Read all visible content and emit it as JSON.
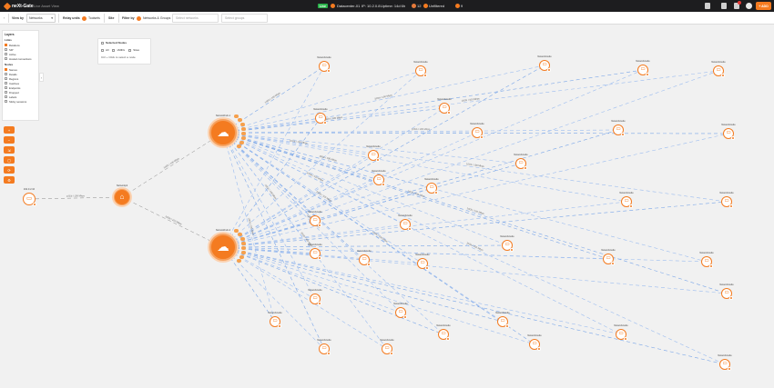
{
  "header": {
    "app_name": "neXt-Gate",
    "app_sub": "Live Asset View",
    "env_badge": "Live",
    "host": "Datacenter-01",
    "ip": "IP: 10.2.0.8",
    "status": "Uptime: 14d 6h",
    "alerts": "12",
    "tag": "Unfiltered",
    "count": "9",
    "add_label": "+ ADD"
  },
  "filters": {
    "view_by_label": "View by",
    "view_by_value": "Networks",
    "relay_label": "Relay units",
    "relay_value": "Toolsets",
    "site_label": "Site",
    "filter_by_label": "Filter by",
    "filter_by_value": "Networks & Groups",
    "search_networks_placeholder": "Select networks",
    "search_groups_placeholder": "Select groups"
  },
  "layers": {
    "title": "Layers",
    "links_title": "Links",
    "links": [
      {
        "label": "Relations",
        "on": true
      },
      {
        "label": "SIP",
        "on": false
      },
      {
        "label": "Active",
        "on": false
      },
      {
        "label": "Hosted connections",
        "on": false
      }
    ],
    "nodes_title": "Nodes",
    "nodes": [
      {
        "label": "Names",
        "on": true
      },
      {
        "label": "Details",
        "on": false
      },
      {
        "label": "Regions",
        "on": false
      },
      {
        "label": "Inactives",
        "on": false
      },
      {
        "label": "Endpoints",
        "on": false
      },
      {
        "label": "Dropped",
        "on": false
      },
      {
        "label": "Labels",
        "on": false
      },
      {
        "label": "Sticky sessions",
        "on": false
      }
    ]
  },
  "selected_panel": {
    "title": "Selected Nodes",
    "opt_all": "All",
    "opt_middle": "xMIDx",
    "opt_sites": "Sites",
    "hint": "Ctrl + Click to select a node"
  },
  "tools": [
    "+",
    "−",
    "⇲",
    "▢",
    "⟳",
    "⚙"
  ],
  "graph": {
    "root": {
      "label": "192.0.2.10"
    },
    "mid": {
      "label": "Networkpit"
    },
    "hubs": [
      {
        "label": "Networkhub-1"
      },
      {
        "label": "Networkhub-2"
      }
    ],
    "leaf_label": "Networknode",
    "link_label": "10Gb / 100 Mbps"
  }
}
